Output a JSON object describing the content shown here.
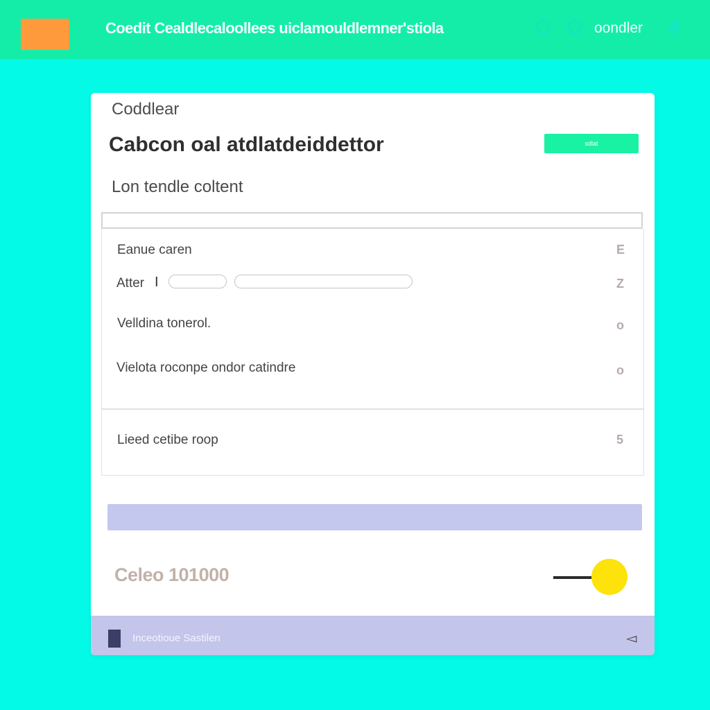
{
  "header": {
    "title": "Coedit Cealdlecaloollees uiclamouldlemner'stiola",
    "order_label": "oondler",
    "badge_number": "4",
    "colors": {
      "bar": "#14eda8",
      "logo": "#ff9a3c",
      "page_background": "#02fae6"
    },
    "icons": [
      "logo-block",
      "circle-icon",
      "circle-icon"
    ]
  },
  "card": {
    "eyebrow": "Coddlear",
    "title": "Cabcon oal atdlatdeiddettor",
    "primary_button_label": "sdlat",
    "subtitle": "Lon tendle coltent",
    "search_value": "",
    "rows": [
      {
        "label": "Eanue caren",
        "num": "E"
      },
      {
        "label": "Atter",
        "num": "Z"
      },
      {
        "label": "Velldina tonerol.",
        "num": "o"
      },
      {
        "label": "Vielota roconpe ondor catindre",
        "num": "o"
      }
    ],
    "group_row": {
      "label": "Lieed cetibe roop",
      "num": "5"
    },
    "total_label": "Celeo 101000",
    "toggle_on": true,
    "colors": {
      "accent": "#19f2a3",
      "progress": "#c4c8ee",
      "toggle": "#fde20b"
    }
  },
  "footer": {
    "label": "Inceotioue Sastilen",
    "icons": [
      "document-icon",
      "speaker-icon"
    ]
  }
}
